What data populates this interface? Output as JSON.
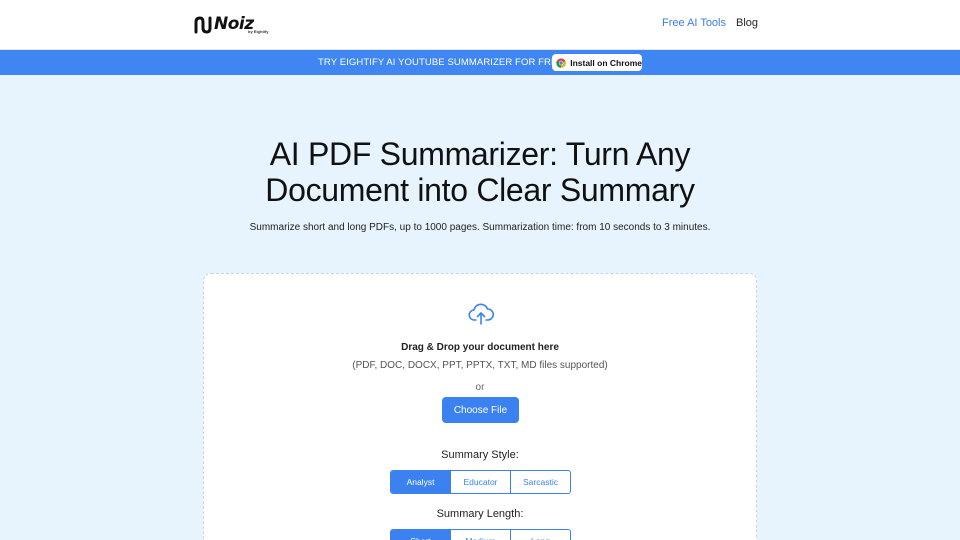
{
  "brand": {
    "name": "Noiz",
    "byline": "by Eightify"
  },
  "nav": {
    "tools_label": "Free AI Tools",
    "blog_label": "Blog"
  },
  "promo": {
    "text": "TRY EIGHTIFY AI YOUTUBE SUMMARIZER FOR FREE",
    "button_label": "Install on Chrome"
  },
  "hero": {
    "title_line1": "AI PDF Summarizer: Turn Any",
    "title_line2": "Document into Clear Summary",
    "subtitle": "Summarize short and long PDFs, up to 1000 pages. Summarization time: from 10 seconds to 3 minutes."
  },
  "upload": {
    "title": "Drag & Drop your document here",
    "formats": "(PDF, DOC, DOCX, PPT, PPTX, TXT, MD files supported)",
    "or": "or",
    "button_label": "Choose File"
  },
  "summary_style": {
    "label": "Summary Style:",
    "options": [
      "Analyst",
      "Educator",
      "Sarcastic"
    ],
    "selected": "Analyst"
  },
  "summary_length": {
    "label": "Summary Length:",
    "options": [
      "Short",
      "Medium",
      "Long"
    ],
    "selected": "Short"
  },
  "colors": {
    "accent": "#3b82f0",
    "promo_bar": "#3f86f2",
    "page_background": "#e7f3fd"
  }
}
